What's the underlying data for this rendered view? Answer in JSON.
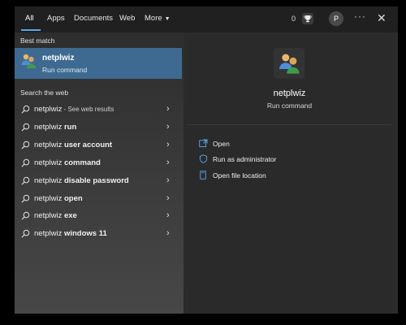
{
  "tabs": [
    {
      "label": "All"
    },
    {
      "label": "Apps"
    },
    {
      "label": "Documents"
    },
    {
      "label": "Web"
    },
    {
      "label": "More"
    }
  ],
  "topbar": {
    "count": "0",
    "avatar_letter": "P",
    "more_label": "···",
    "close_label": "✕"
  },
  "sections": {
    "best_match": "Best match",
    "search_web": "Search the web"
  },
  "best_match": {
    "title": "netplwiz",
    "subtitle": "Run command"
  },
  "web_results": [
    {
      "prefix": "netplwiz",
      "bold": "",
      "suffix": " - See web results"
    },
    {
      "prefix": "netplwiz ",
      "bold": "run",
      "suffix": ""
    },
    {
      "prefix": "netplwiz ",
      "bold": "user account",
      "suffix": ""
    },
    {
      "prefix": "netplwiz ",
      "bold": "command",
      "suffix": ""
    },
    {
      "prefix": "netplwiz ",
      "bold": "disable password",
      "suffix": ""
    },
    {
      "prefix": "netplwiz ",
      "bold": "open",
      "suffix": ""
    },
    {
      "prefix": "netplwiz ",
      "bold": "exe",
      "suffix": ""
    },
    {
      "prefix": "netplwiz ",
      "bold": "windows 11",
      "suffix": ""
    }
  ],
  "preview": {
    "name": "netplwiz",
    "type": "Run command",
    "actions": [
      {
        "label": "Open",
        "icon": "open-icon"
      },
      {
        "label": "Run as administrator",
        "icon": "shield-icon"
      },
      {
        "label": "Open file location",
        "icon": "folder-icon"
      }
    ]
  },
  "colors": {
    "accent": "#5aa8ea",
    "selected": "#3e6a91"
  }
}
